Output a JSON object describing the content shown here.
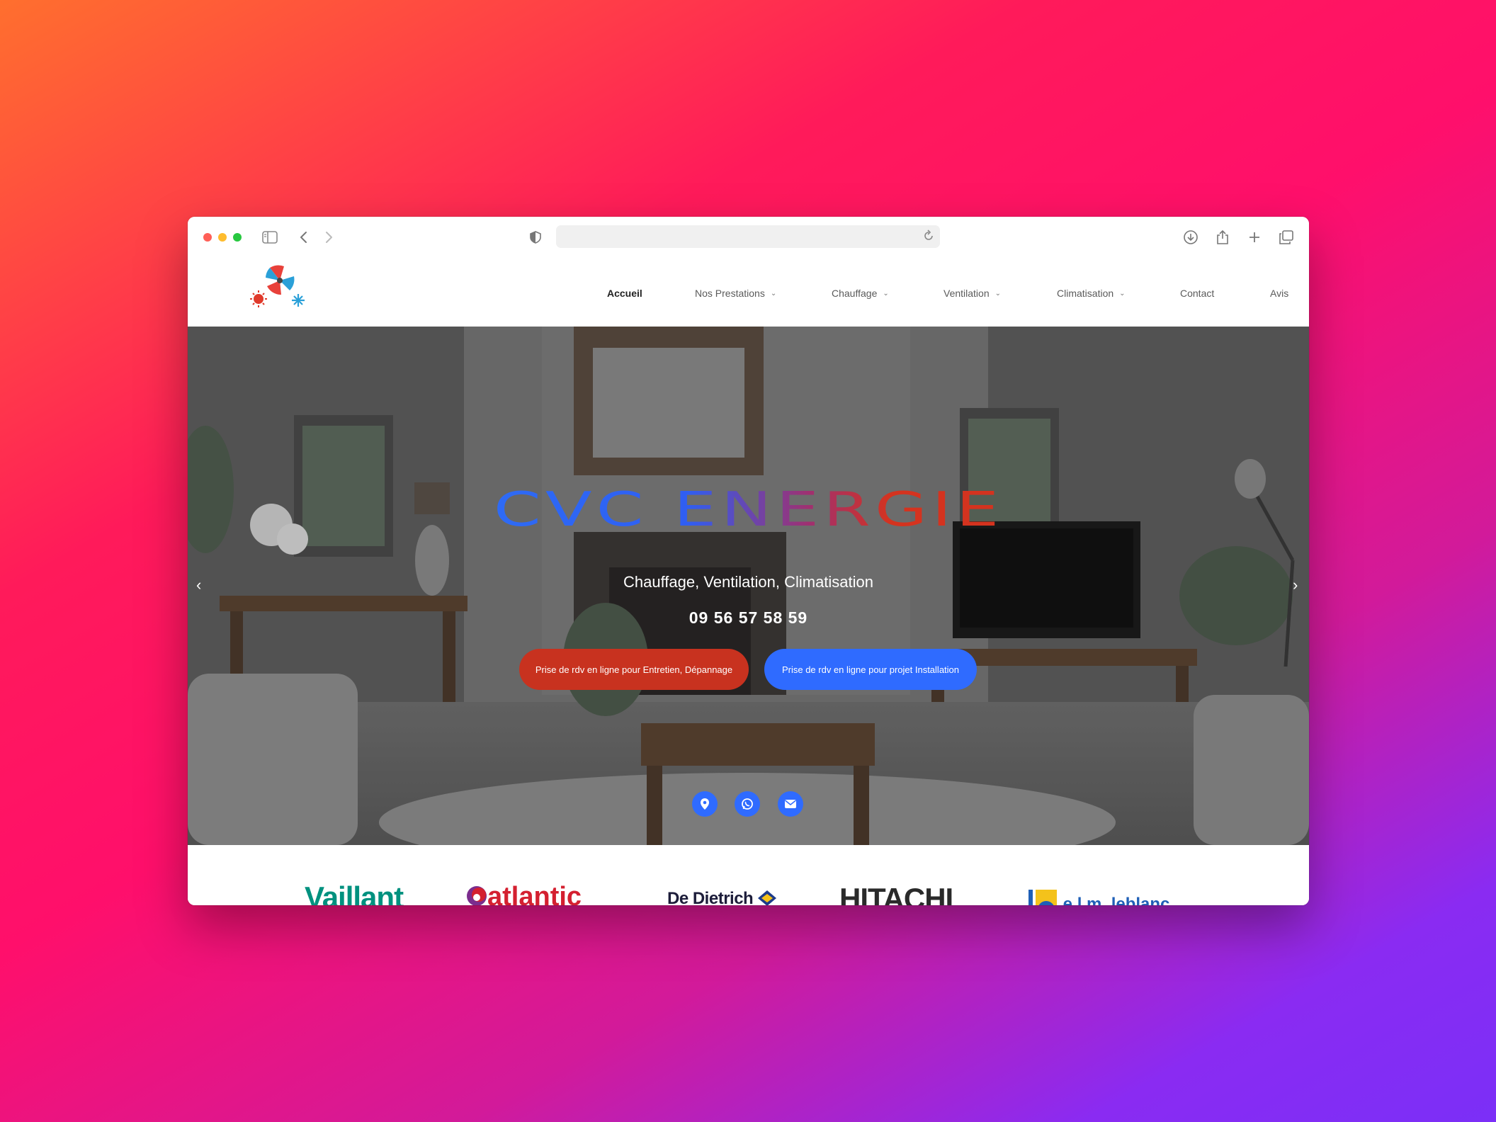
{
  "browser": {
    "address_text": "",
    "icons": [
      "sidebar-icon",
      "back-icon",
      "forward-icon",
      "shield-icon",
      "reload-icon",
      "download-icon",
      "share-icon",
      "plus-icon",
      "tabs-icon"
    ]
  },
  "site": {
    "nav": [
      {
        "label": "Accueil",
        "active": true,
        "dropdown": false
      },
      {
        "label": "Nos Prestations",
        "active": false,
        "dropdown": true
      },
      {
        "label": "Chauffage",
        "active": false,
        "dropdown": true
      },
      {
        "label": "Ventilation",
        "active": false,
        "dropdown": true
      },
      {
        "label": "Climatisation",
        "active": false,
        "dropdown": true
      },
      {
        "label": "Contact",
        "active": false,
        "dropdown": false
      },
      {
        "label": "Avis",
        "active": false,
        "dropdown": false
      }
    ]
  },
  "hero": {
    "title": "CVC ENERGIE",
    "subtitle": "Chauffage, Ventilation, Climatisation",
    "phone": "09 56 57 58 59",
    "cta_primary": "Prise de rdv en ligne pour Entretien, Dépannage",
    "cta_secondary": "Prise de rdv en ligne pour projet Installation",
    "prev_arrow": "‹",
    "next_arrow": "›",
    "social": [
      "map-pin-icon",
      "whatsapp-icon",
      "envelope-icon"
    ]
  },
  "brands": {
    "vaillant": "Vaillant",
    "atlantic": "atlantic",
    "dedietrich": "De Dietrich",
    "hitachi": "HITACHI",
    "elm": "e.l.m. leblanc"
  },
  "colors": {
    "accent_blue": "#2f6bff",
    "accent_red": "#c8321f"
  }
}
